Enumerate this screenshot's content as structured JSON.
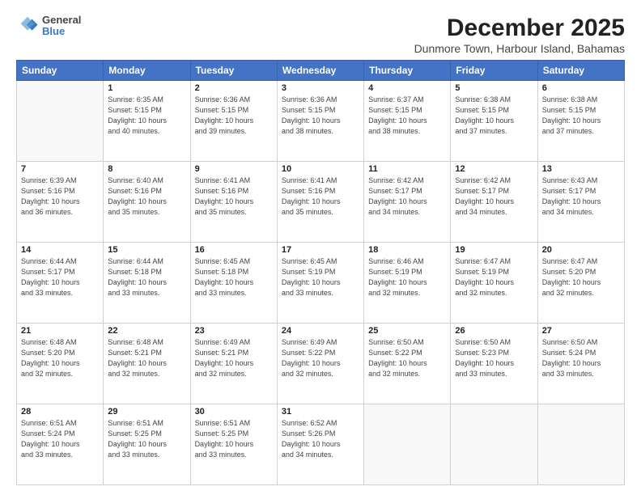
{
  "header": {
    "logo_line1": "General",
    "logo_line2": "Blue",
    "title": "December 2025",
    "subtitle": "Dunmore Town, Harbour Island, Bahamas"
  },
  "calendar": {
    "days_of_week": [
      "Sunday",
      "Monday",
      "Tuesday",
      "Wednesday",
      "Thursday",
      "Friday",
      "Saturday"
    ],
    "weeks": [
      [
        {
          "day": "",
          "detail": ""
        },
        {
          "day": "1",
          "detail": "Sunrise: 6:35 AM\nSunset: 5:15 PM\nDaylight: 10 hours\nand 40 minutes."
        },
        {
          "day": "2",
          "detail": "Sunrise: 6:36 AM\nSunset: 5:15 PM\nDaylight: 10 hours\nand 39 minutes."
        },
        {
          "day": "3",
          "detail": "Sunrise: 6:36 AM\nSunset: 5:15 PM\nDaylight: 10 hours\nand 38 minutes."
        },
        {
          "day": "4",
          "detail": "Sunrise: 6:37 AM\nSunset: 5:15 PM\nDaylight: 10 hours\nand 38 minutes."
        },
        {
          "day": "5",
          "detail": "Sunrise: 6:38 AM\nSunset: 5:15 PM\nDaylight: 10 hours\nand 37 minutes."
        },
        {
          "day": "6",
          "detail": "Sunrise: 6:38 AM\nSunset: 5:15 PM\nDaylight: 10 hours\nand 37 minutes."
        }
      ],
      [
        {
          "day": "7",
          "detail": "Sunrise: 6:39 AM\nSunset: 5:16 PM\nDaylight: 10 hours\nand 36 minutes."
        },
        {
          "day": "8",
          "detail": "Sunrise: 6:40 AM\nSunset: 5:16 PM\nDaylight: 10 hours\nand 35 minutes."
        },
        {
          "day": "9",
          "detail": "Sunrise: 6:41 AM\nSunset: 5:16 PM\nDaylight: 10 hours\nand 35 minutes."
        },
        {
          "day": "10",
          "detail": "Sunrise: 6:41 AM\nSunset: 5:16 PM\nDaylight: 10 hours\nand 35 minutes."
        },
        {
          "day": "11",
          "detail": "Sunrise: 6:42 AM\nSunset: 5:17 PM\nDaylight: 10 hours\nand 34 minutes."
        },
        {
          "day": "12",
          "detail": "Sunrise: 6:42 AM\nSunset: 5:17 PM\nDaylight: 10 hours\nand 34 minutes."
        },
        {
          "day": "13",
          "detail": "Sunrise: 6:43 AM\nSunset: 5:17 PM\nDaylight: 10 hours\nand 34 minutes."
        }
      ],
      [
        {
          "day": "14",
          "detail": "Sunrise: 6:44 AM\nSunset: 5:17 PM\nDaylight: 10 hours\nand 33 minutes."
        },
        {
          "day": "15",
          "detail": "Sunrise: 6:44 AM\nSunset: 5:18 PM\nDaylight: 10 hours\nand 33 minutes."
        },
        {
          "day": "16",
          "detail": "Sunrise: 6:45 AM\nSunset: 5:18 PM\nDaylight: 10 hours\nand 33 minutes."
        },
        {
          "day": "17",
          "detail": "Sunrise: 6:45 AM\nSunset: 5:19 PM\nDaylight: 10 hours\nand 33 minutes."
        },
        {
          "day": "18",
          "detail": "Sunrise: 6:46 AM\nSunset: 5:19 PM\nDaylight: 10 hours\nand 32 minutes."
        },
        {
          "day": "19",
          "detail": "Sunrise: 6:47 AM\nSunset: 5:19 PM\nDaylight: 10 hours\nand 32 minutes."
        },
        {
          "day": "20",
          "detail": "Sunrise: 6:47 AM\nSunset: 5:20 PM\nDaylight: 10 hours\nand 32 minutes."
        }
      ],
      [
        {
          "day": "21",
          "detail": "Sunrise: 6:48 AM\nSunset: 5:20 PM\nDaylight: 10 hours\nand 32 minutes."
        },
        {
          "day": "22",
          "detail": "Sunrise: 6:48 AM\nSunset: 5:21 PM\nDaylight: 10 hours\nand 32 minutes."
        },
        {
          "day": "23",
          "detail": "Sunrise: 6:49 AM\nSunset: 5:21 PM\nDaylight: 10 hours\nand 32 minutes."
        },
        {
          "day": "24",
          "detail": "Sunrise: 6:49 AM\nSunset: 5:22 PM\nDaylight: 10 hours\nand 32 minutes."
        },
        {
          "day": "25",
          "detail": "Sunrise: 6:50 AM\nSunset: 5:22 PM\nDaylight: 10 hours\nand 32 minutes."
        },
        {
          "day": "26",
          "detail": "Sunrise: 6:50 AM\nSunset: 5:23 PM\nDaylight: 10 hours\nand 33 minutes."
        },
        {
          "day": "27",
          "detail": "Sunrise: 6:50 AM\nSunset: 5:24 PM\nDaylight: 10 hours\nand 33 minutes."
        }
      ],
      [
        {
          "day": "28",
          "detail": "Sunrise: 6:51 AM\nSunset: 5:24 PM\nDaylight: 10 hours\nand 33 minutes."
        },
        {
          "day": "29",
          "detail": "Sunrise: 6:51 AM\nSunset: 5:25 PM\nDaylight: 10 hours\nand 33 minutes."
        },
        {
          "day": "30",
          "detail": "Sunrise: 6:51 AM\nSunset: 5:25 PM\nDaylight: 10 hours\nand 33 minutes."
        },
        {
          "day": "31",
          "detail": "Sunrise: 6:52 AM\nSunset: 5:26 PM\nDaylight: 10 hours\nand 34 minutes."
        },
        {
          "day": "",
          "detail": ""
        },
        {
          "day": "",
          "detail": ""
        },
        {
          "day": "",
          "detail": ""
        }
      ]
    ]
  }
}
